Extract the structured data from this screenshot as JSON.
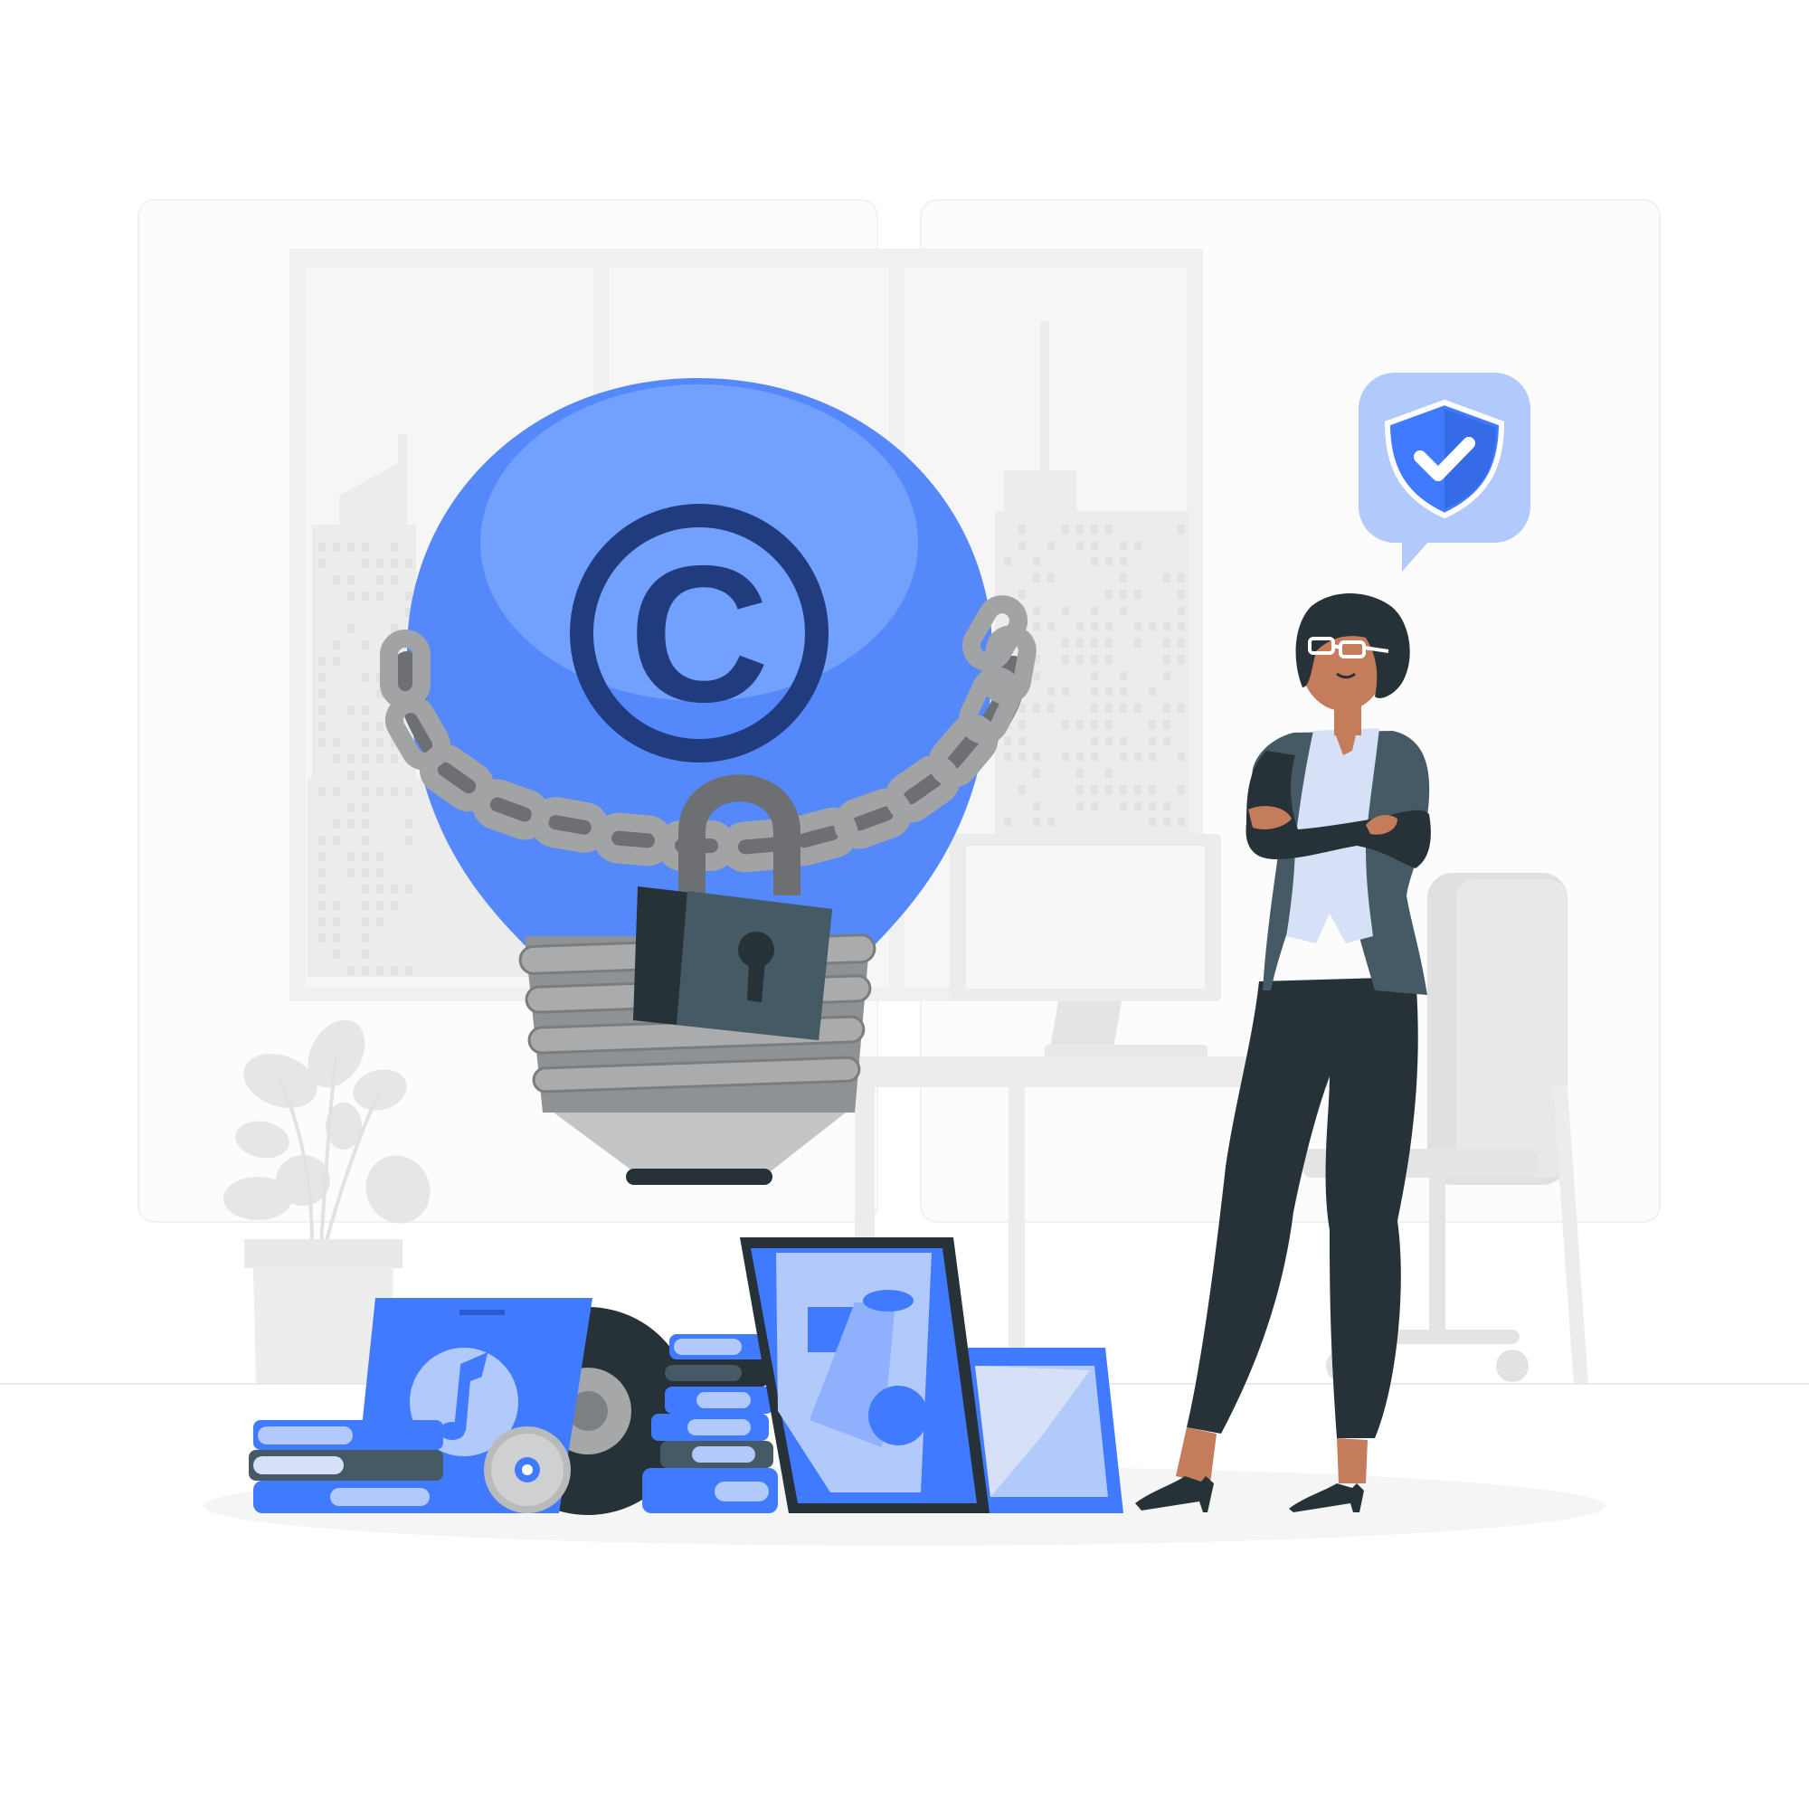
{
  "scene": {
    "subject": "copyright-protection-illustration",
    "copyright_symbol": "C"
  },
  "colors": {
    "background": "#ffffff",
    "panel": "#fbfbfb",
    "panel_border": "#f0f0f0",
    "window_light": "#f4f4f4",
    "building": "#ececec",
    "furniture": "#e6e6e6",
    "accent_blue": "#407bff",
    "bulb_blue": "#5589fb",
    "bulb_highlight": "#72a0fd",
    "copyright_dark": "#213c7e",
    "light_blue": "#b1c9fb",
    "chain_gray": "#9fa0a2",
    "chain_dark": "#6d6f72",
    "lock_dark": "#263238",
    "lock_body": "#455a64",
    "screw_gray": "#8f9294",
    "base_gray": "#c3c5c6",
    "skin": "#c47c5a",
    "suit": "#263238",
    "shirt": "#d6e1f8",
    "floor_shadow": "#f5f5f5"
  },
  "icons": {
    "shield": "shield-check-icon",
    "music": "music-note-icon",
    "lock": "padlock-icon"
  }
}
